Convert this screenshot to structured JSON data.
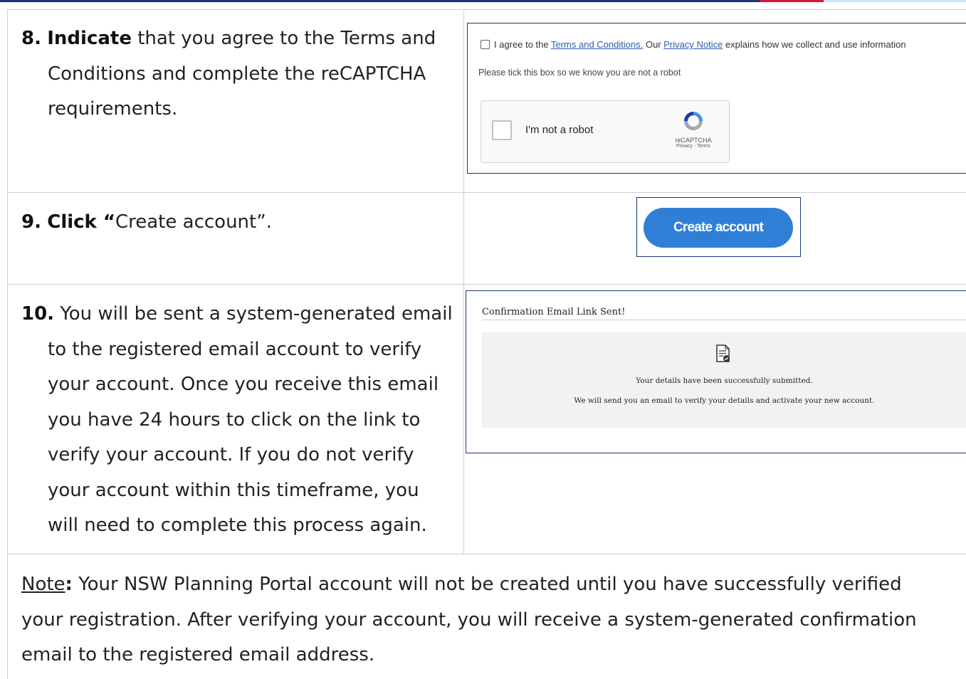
{
  "step8": {
    "number": "8.",
    "keyword": "Indicate",
    "line1_rest": " that you agree to the Terms and",
    "line2": "Conditions and complete the reCAPTCHA",
    "line3": "requirements."
  },
  "step9": {
    "number": "9.",
    "keyword": "Click “",
    "rest": "Create account”."
  },
  "step10": {
    "number": "10.",
    "line1_rest": " You will be sent a system-generated email",
    "lines": [
      "to the registered email account to verify",
      "your account. Once you receive this email",
      "you have 24 hours to click on the link to",
      "verify your account. If you do not verify",
      "your account within this timeframe, you",
      "will need to complete this process again."
    ]
  },
  "terms_panel": {
    "agree_prefix": "I agree to the ",
    "terms_link": "Terms and Conditions.",
    "middle": " Our ",
    "privacy_link": "Privacy Notice",
    "suffix": " explains how we collect and use information",
    "tick_note": "Please tick this box so we know you are not a robot",
    "captcha_label": "I'm not a robot",
    "captcha_brand": "reCAPTCHA",
    "captcha_legal": "Privacy - Terms"
  },
  "create_button": {
    "label": "Create account"
  },
  "confirmation_panel": {
    "title": "Confirmation Email Link Sent!",
    "line1": "Your details have been successfully submitted.",
    "line2": "We will send you an email to verify your details and activate your new account."
  },
  "note": {
    "label": "Note",
    "colon": ":",
    "line1_rest": " Your NSW Planning Portal account will not be created until you have successfully verified",
    "line2": "your registration. After verifying your account, you will receive a system-generated confirmation",
    "line3": "email to the registered email address."
  },
  "colors": {
    "navy": "#1d3470",
    "red": "#d7153a",
    "button_blue": "#2f7fd6",
    "link_blue": "#2a5db0"
  }
}
